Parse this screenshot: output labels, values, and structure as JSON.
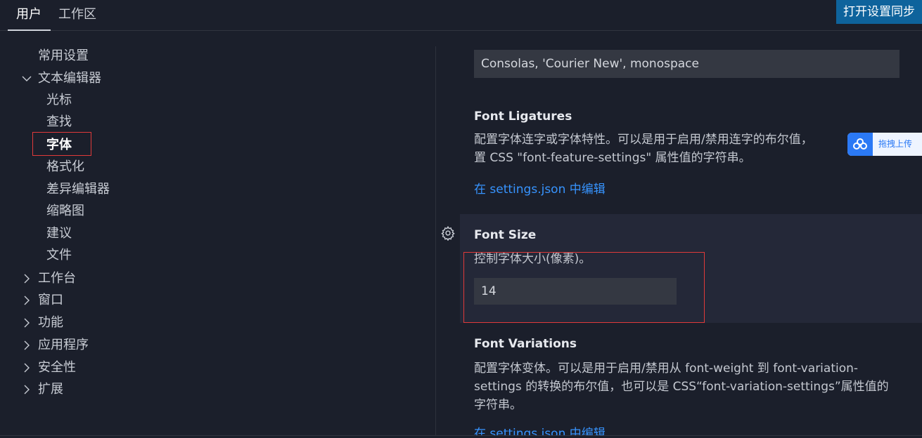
{
  "tabs": {
    "user": "用户",
    "workspace": "工作区"
  },
  "sync_button": "打开设置同步",
  "tree": {
    "commonly_used": "常用设置",
    "text_editor": "文本编辑器",
    "cursor": "光标",
    "find": "查找",
    "font": "字体",
    "formatting": "格式化",
    "diff_editor": "差异编辑器",
    "minimap": "缩略图",
    "suggestions": "建议",
    "files": "文件",
    "workbench": "工作台",
    "window": "窗口",
    "features": "功能",
    "application": "应用程序",
    "security": "安全性",
    "extensions": "扩展"
  },
  "settings": {
    "font_family_value": "Consolas, 'Courier New', monospace",
    "font_ligatures": {
      "title": "Font Ligatures",
      "desc_line1": "配置字体连字或字体特性。可以是用于启用/禁用连字的布尔值，",
      "desc_line2": "置 CSS \"font-feature-settings\" 属性值的字符串。",
      "edit_link": "在 settings.json 中编辑"
    },
    "font_size": {
      "title": "Font Size",
      "desc": "控制字体大小(像素)。",
      "value": "14"
    },
    "font_variations": {
      "title": "Font Variations",
      "desc_line1": "配置字体变体。可以是用于启用/禁用从 font-weight 到 font-variation-",
      "desc_line2": "settings 的转换的布尔值，也可以是 CSS“font-variation-settings”属性值的",
      "desc_line3": "字符串。",
      "edit_link": "在 settings.json 中编辑"
    }
  },
  "baidu_widget": {
    "label": "拖拽上传"
  },
  "colors": {
    "background": "#1b1f2b",
    "accent_button": "#0e639c",
    "link": "#3794ff",
    "highlight_border": "#e03a3a",
    "focused_row": "#242838"
  }
}
